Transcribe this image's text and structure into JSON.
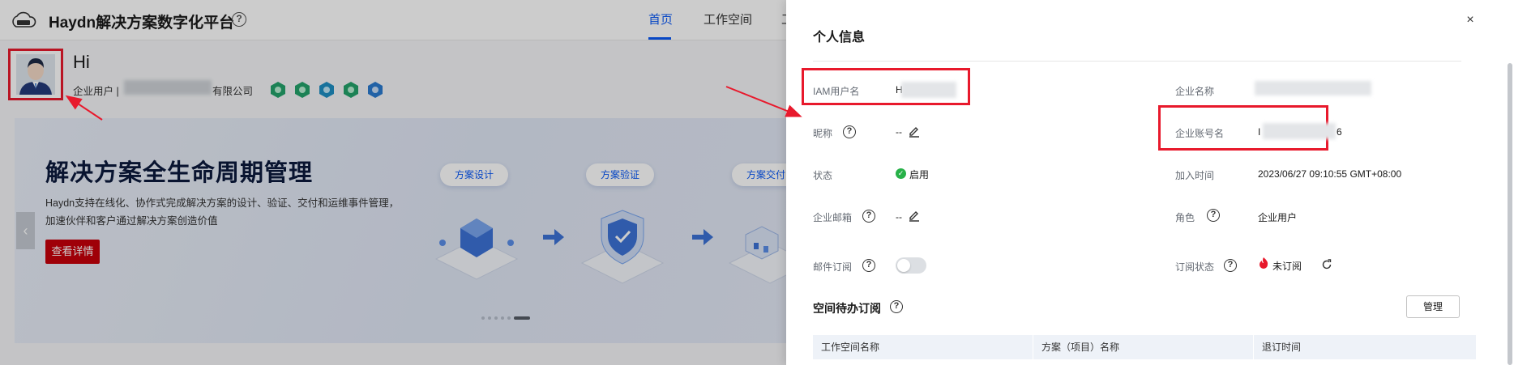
{
  "app": {
    "title": "Haydn解决方案数字化平台",
    "help_glyph": "?",
    "nav": {
      "home": "首页",
      "workspace": "工作空间",
      "extra": "工"
    }
  },
  "profile": {
    "greeting": "Hi",
    "user_type_label": "企业用户 | ",
    "company_suffix": "有限公司",
    "badge_color": "#23a36b"
  },
  "banner": {
    "title": "解决方案全生命周期管理",
    "line1": "Haydn支持在线化、协作式完成解决方案的设计、验证、交付和运维事件管理，",
    "line2": "加速伙伴和客户通过解决方案创造价值",
    "detail_button": "查看详情",
    "pills": [
      "方案设计",
      "方案验证",
      "方案交付"
    ],
    "prev_glyph": "‹"
  },
  "drawer": {
    "title": "个人信息",
    "close_glyph": "×",
    "fields": {
      "iam_user_label": "IAM用户名",
      "iam_user_value_prefix": "H",
      "nickname_label": "昵称",
      "nickname_value": "--",
      "status_label": "状态",
      "status_value": "启用",
      "email_label": "企业邮箱",
      "email_value": "--",
      "mail_sub_label": "邮件订阅",
      "company_name_label": "企业名称",
      "company_account_label": "企业账号名",
      "company_account_prefix": "I",
      "company_account_suffix": "6",
      "join_time_label": "加入时间",
      "join_time_value": "2023/06/27 09:10:55 GMT+08:00",
      "role_label": "角色",
      "role_value": "企业用户",
      "sub_status_label": "订阅状态",
      "sub_status_value": "未订阅"
    },
    "mail_sub_enabled": false,
    "section_title": "空间待办订阅",
    "manage_button": "管理",
    "table_columns": [
      "工作空间名称",
      "方案（项目）名称",
      "退订时间"
    ],
    "help_glyph": "?",
    "status_ok_glyph": "✓"
  },
  "colors": {
    "accent": "#0a59f7",
    "brand_red": "#c7000b",
    "highlight_red": "#e8192c",
    "status_green": "#27b148",
    "unsub_red": "#e8192c"
  }
}
